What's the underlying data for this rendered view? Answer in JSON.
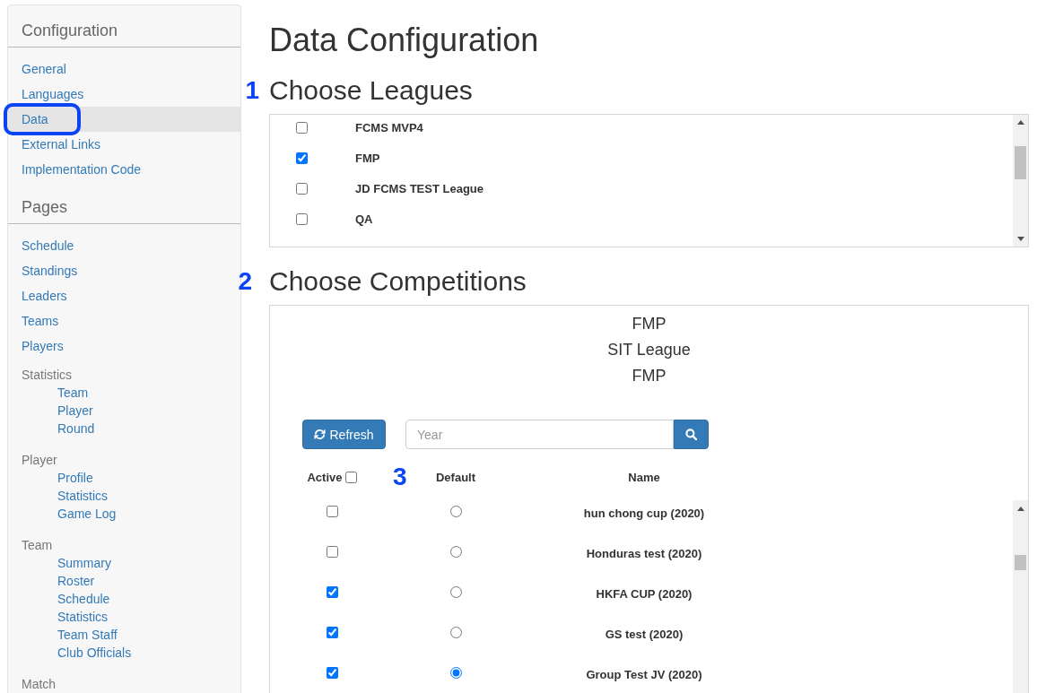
{
  "sidebar": {
    "sections": [
      {
        "heading": "Configuration",
        "items": [
          {
            "kind": "link",
            "label": "General",
            "selected": false,
            "circled": false
          },
          {
            "kind": "link",
            "label": "Languages",
            "selected": false,
            "circled": false
          },
          {
            "kind": "link",
            "label": "Data",
            "selected": true,
            "circled": true
          },
          {
            "kind": "link",
            "label": "External Links",
            "selected": false,
            "circled": false
          },
          {
            "kind": "link",
            "label": "Implementation Code",
            "selected": false,
            "circled": false
          }
        ]
      },
      {
        "heading": "Pages",
        "items": [
          {
            "kind": "link",
            "label": "Schedule",
            "selected": false,
            "circled": false
          },
          {
            "kind": "link",
            "label": "Standings",
            "selected": false,
            "circled": false
          },
          {
            "kind": "link",
            "label": "Leaders",
            "selected": false,
            "circled": false
          },
          {
            "kind": "link",
            "label": "Teams",
            "selected": false,
            "circled": false
          },
          {
            "kind": "link",
            "label": "Players",
            "selected": false,
            "circled": false
          },
          {
            "kind": "group",
            "label": "Statistics",
            "children": [
              {
                "label": "Team",
                "selected": false
              },
              {
                "label": "Player",
                "selected": false
              },
              {
                "label": "Round",
                "selected": false
              }
            ]
          },
          {
            "kind": "group",
            "label": "Player",
            "children": [
              {
                "label": "Profile",
                "selected": false
              },
              {
                "label": "Statistics",
                "selected": false
              },
              {
                "label": "Game Log",
                "selected": false
              }
            ]
          },
          {
            "kind": "group",
            "label": "Team",
            "children": [
              {
                "label": "Summary",
                "selected": false
              },
              {
                "label": "Roster",
                "selected": false
              },
              {
                "label": "Schedule",
                "selected": false
              },
              {
                "label": "Statistics",
                "selected": false
              },
              {
                "label": "Team Staff",
                "selected": false
              },
              {
                "label": "Club Officials",
                "selected": false
              }
            ]
          },
          {
            "kind": "group",
            "label": "Match"
          }
        ]
      }
    ]
  },
  "main": {
    "title": "Data Configuration",
    "leagues": {
      "marker": "1",
      "heading": "Choose Leagues",
      "rows": [
        {
          "name": "FCMS MVP4",
          "checked": false
        },
        {
          "name": "FMP",
          "checked": true
        },
        {
          "name": "JD FCMS TEST League",
          "checked": false
        },
        {
          "name": "QA",
          "checked": false
        }
      ]
    },
    "competitions": {
      "marker": "2",
      "heading": "Choose Competitions",
      "league_lines": [
        "FMP",
        "SIT League",
        "FMP"
      ],
      "refresh_button": "Refresh",
      "search": {
        "placeholder": "Year"
      },
      "table": {
        "marker": "3",
        "columns": [
          {
            "label": "Active",
            "kind": "checkbox",
            "checked": false
          },
          {
            "label": "Default",
            "kind": "text"
          },
          {
            "label": "Name",
            "kind": "text"
          }
        ],
        "rows": [
          {
            "active": false,
            "selected": false,
            "name": "hun chong cup (2020)"
          },
          {
            "active": false,
            "selected": false,
            "name": "Honduras test (2020)"
          },
          {
            "active": true,
            "selected": false,
            "name": "HKFA CUP (2020)"
          },
          {
            "active": true,
            "selected": false,
            "name": "GS test (2020)"
          },
          {
            "active": true,
            "selected": true,
            "name": "Group Test JV (2020)"
          }
        ]
      }
    }
  }
}
